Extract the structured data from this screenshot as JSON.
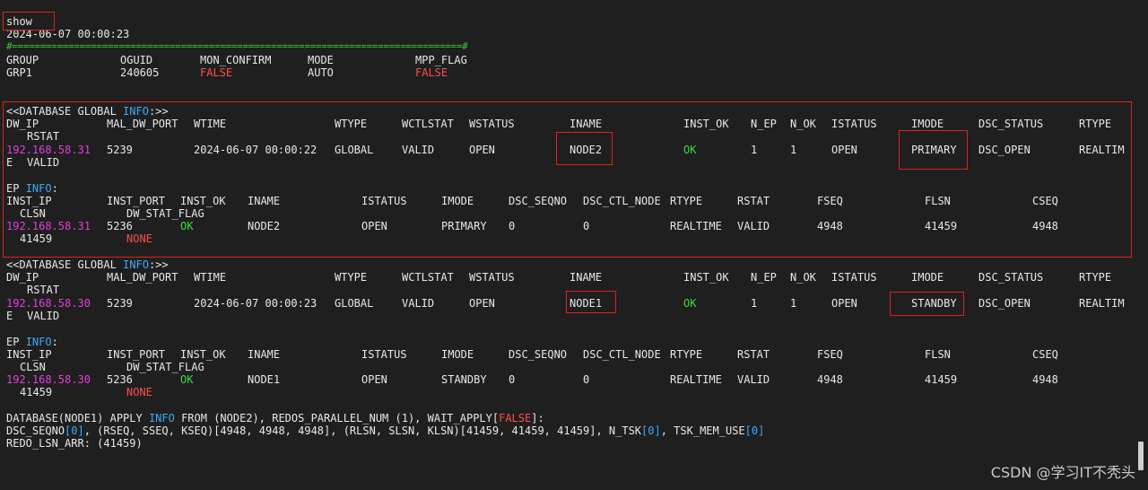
{
  "terminal": {
    "command": "show",
    "timestamp": "2024-06-07 00:00:23",
    "separator": "#================================================================================#",
    "group_table": {
      "headers": [
        "GROUP",
        "OGUID",
        "MON_CONFIRM",
        "MODE",
        "MPP_FLAG"
      ],
      "row": [
        "GRP1",
        "240605",
        "FALSE",
        "AUTO",
        "FALSE"
      ]
    },
    "db_global_info": {
      "prefix": "<<DATABASE GLOBAL ",
      "info": "INFO",
      "suffix": ":>>"
    },
    "db_headers": [
      "DW_IP",
      "MAL_DW_PORT",
      "WTIME",
      "WTYPE",
      "WCTLSTAT",
      "WSTATUS",
      "INAME",
      "INST_OK",
      "N_EP",
      "N_OK",
      "ISTATUS",
      "IMODE",
      "DSC_STATUS",
      "RTYPE",
      "RSTAT"
    ],
    "db_row_1": {
      "ip": "192.168.58.31",
      "port": "5239",
      "wtime": "2024-06-07 00:00:22",
      "wtype": "GLOBAL",
      "wctlstat": "VALID",
      "wstatus": "OPEN",
      "iname": "NODE2",
      "inst_ok": "OK",
      "n_ep": "1",
      "n_ok": "1",
      "istatus": "OPEN",
      "imode": "PRIMARY",
      "dsc_status": "DSC_OPEN",
      "rtype_head": "REALTIM",
      "rtype_tail": "E",
      "rstat": "VALID"
    },
    "ep_info": {
      "prefix": "EP ",
      "info": "INFO",
      "suffix": ":"
    },
    "ep_headers": [
      "INST_IP",
      "INST_PORT",
      "INST_OK",
      "INAME",
      "ISTATUS",
      "IMODE",
      "DSC_SEQNO",
      "DSC_CTL_NODE",
      "RTYPE",
      "RSTAT",
      "FSEQ",
      "FLSN",
      "CSEQ",
      "CLSN",
      "DW_STAT_FLAG"
    ],
    "ep_row_1": {
      "ip": "192.168.58.31",
      "port": "5236",
      "inst_ok": "OK",
      "iname": "NODE2",
      "istatus": "OPEN",
      "imode": "PRIMARY",
      "dsc_seqno": "0",
      "dsc_ctl_node": "0",
      "rtype": "REALTIME",
      "rstat": "VALID",
      "fseq": "4948",
      "flsn": "41459",
      "cseq": "4948",
      "clsn": "41459",
      "dw_stat_flag": "NONE"
    },
    "db_row_2": {
      "ip": "192.168.58.30",
      "port": "5239",
      "wtime": "2024-06-07 00:00:23",
      "wtype": "GLOBAL",
      "wctlstat": "VALID",
      "wstatus": "OPEN",
      "iname": "NODE1",
      "inst_ok": "OK",
      "n_ep": "1",
      "n_ok": "1",
      "istatus": "OPEN",
      "imode": "STANDBY",
      "dsc_status": "DSC_OPEN",
      "rtype_head": "REALTIM",
      "rtype_tail": "E",
      "rstat": "VALID"
    },
    "ep_row_2": {
      "ip": "192.168.58.30",
      "port": "5236",
      "inst_ok": "OK",
      "iname": "NODE1",
      "istatus": "OPEN",
      "imode": "STANDBY",
      "dsc_seqno": "0",
      "dsc_ctl_node": "0",
      "rtype": "REALTIME",
      "rstat": "VALID",
      "fseq": "4948",
      "flsn": "41459",
      "cseq": "4948",
      "clsn": "41459",
      "dw_stat_flag": "NONE"
    },
    "apply_info": {
      "a": "DATABASE(NODE1) APPLY ",
      "info": "INFO",
      "b": " FROM (NODE2), REDOS_PARALLEL_NUM (1), WAIT_APPLY[",
      "false": "FALSE",
      "c": "]:"
    },
    "dsc_seq": {
      "a": "DSC_SEQNO",
      "idx0": "[0]",
      "b": ", (RSEQ, SSEQ, KSEQ)[4948, 4948, 4948], (RLSN, SLSN, KLSN)[41459, 41459, 41459], N_TSK",
      "idx1": "[0]",
      "c": ", TSK_MEM_USE",
      "idx2": "[0]"
    },
    "redo_lsn": "REDO_LSN_ARR: (41459)"
  },
  "watermark": "CSDN @学习IT不秃头",
  "colors": {
    "background": "#1f1f1f",
    "text": "#e8e8e8",
    "ip_magenta": "#e040d8",
    "false_red": "#ff4d4d",
    "ok_green": "#3ddc3d",
    "info_cyan": "#3fa9f5",
    "highlight_box": "#e02020"
  }
}
